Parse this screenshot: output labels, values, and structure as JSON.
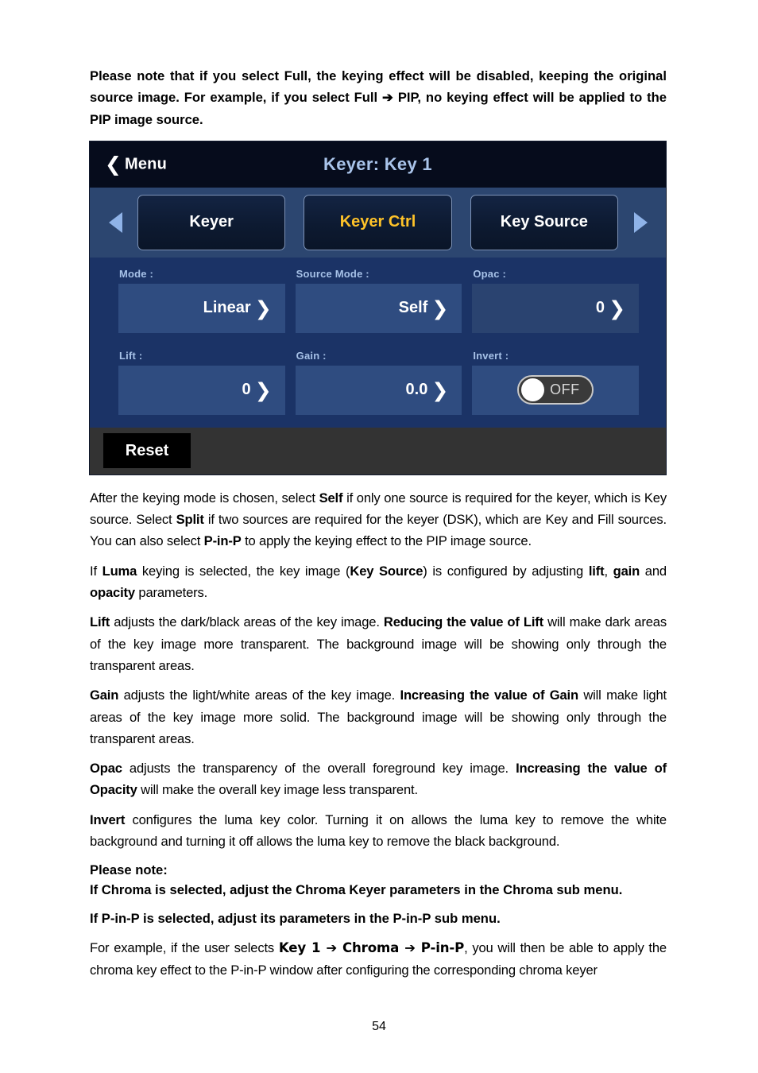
{
  "document": {
    "page_number": "54",
    "intro_note": "Please note that if you select Full, the keying effect will be disabled, keeping the original source image. For example, if you select Full ➔ PIP, no keying effect will be applied to the PIP image source."
  },
  "device_panel": {
    "titlebar": {
      "back_label": "Menu",
      "back_icon": "chevron-left-icon",
      "title": "Keyer: Key 1",
      "title_color": "#a9c4ea",
      "background": "#060c1c"
    },
    "tabstrip": {
      "prev_icon": "triangle-left-icon",
      "next_icon": "triangle-right-icon",
      "active_color": "#ffc329",
      "tabs": [
        {
          "label": "Keyer",
          "active": false
        },
        {
          "label": "Keyer Ctrl",
          "active": true
        },
        {
          "label": "Key Source",
          "active": false
        }
      ]
    },
    "parameters": [
      [
        {
          "label": "Mode :",
          "value": "Linear",
          "type": "stepper",
          "chevron": "chevron-right-icon"
        },
        {
          "label": "Source Mode :",
          "value": "Self",
          "type": "stepper",
          "chevron": "chevron-right-icon"
        },
        {
          "label": "Opac :",
          "value": "0",
          "type": "stepper",
          "chevron": "chevron-right-icon"
        }
      ],
      [
        {
          "label": "Lift :",
          "value": "0",
          "type": "stepper",
          "chevron": "chevron-right-icon"
        },
        {
          "label": "Gain :",
          "value": "0.0",
          "type": "stepper",
          "chevron": "chevron-right-icon"
        },
        {
          "label": "Invert :",
          "value": "OFF",
          "type": "toggle",
          "state": "off"
        }
      ]
    ],
    "bottom": {
      "reset_label": "Reset"
    }
  },
  "body": {
    "p1": {
      "s1": "After the keying mode is chosen, select ",
      "b1": "Self",
      "s2": " if only one source is required for the keyer, which is Key source. Select ",
      "b2": "Split",
      "s3": " if two sources are required for the keyer (DSK), which are Key and Fill sources. You can also select ",
      "b3": "P-in-P",
      "s4": " to apply the keying effect to the PIP image source."
    },
    "p2": {
      "s1": "If ",
      "b1": "Luma",
      "s2": " keying is selected, the key image (",
      "b2": "Key Source",
      "s3": ") is configured by adjusting ",
      "b3": "lift",
      "s4": ", ",
      "b4": "gain",
      "s5": " and ",
      "b5": "opacity",
      "s6": " parameters."
    },
    "p3": {
      "b1": "Lift",
      "s1": " adjusts the dark/black areas of the key image. ",
      "b2": "Reducing the value of Lift",
      "s2": " will make dark areas of the key image more transparent. The background image will be showing only through the transparent areas."
    },
    "p4": {
      "b1": "Gain",
      "s1": " adjusts the light/white areas of the key image. ",
      "b2": "Increasing the value of Gain",
      "s2": " will make light areas of the key image more solid. The background image will be showing only through the transparent areas."
    },
    "p5": {
      "b1": "Opac",
      "s1": " adjusts the transparency of the overall foreground key image. ",
      "b2": "Increasing the value of Opacity",
      "s2": " will make the overall key image less transparent."
    },
    "p6": {
      "b1": "Invert",
      "s1": " configures the luma key color. Turning it on allows the luma key to remove the white background and turning it off allows the luma key to remove the black background."
    },
    "note": {
      "line1": "Please note:",
      "line2": "If Chroma is selected, adjust the Chroma Keyer parameters in the Chroma sub menu.",
      "line3": "If P-in-P is selected, adjust its parameters in the P-in-P sub menu."
    },
    "p7": {
      "s1": "For example, if the user selects ",
      "b1": "Key 1 ➔ Chroma ➔ P-in-P",
      "s2": ", you will then be able to apply the chroma key effect to the P-in-P window after configuring the corresponding chroma keyer"
    }
  }
}
